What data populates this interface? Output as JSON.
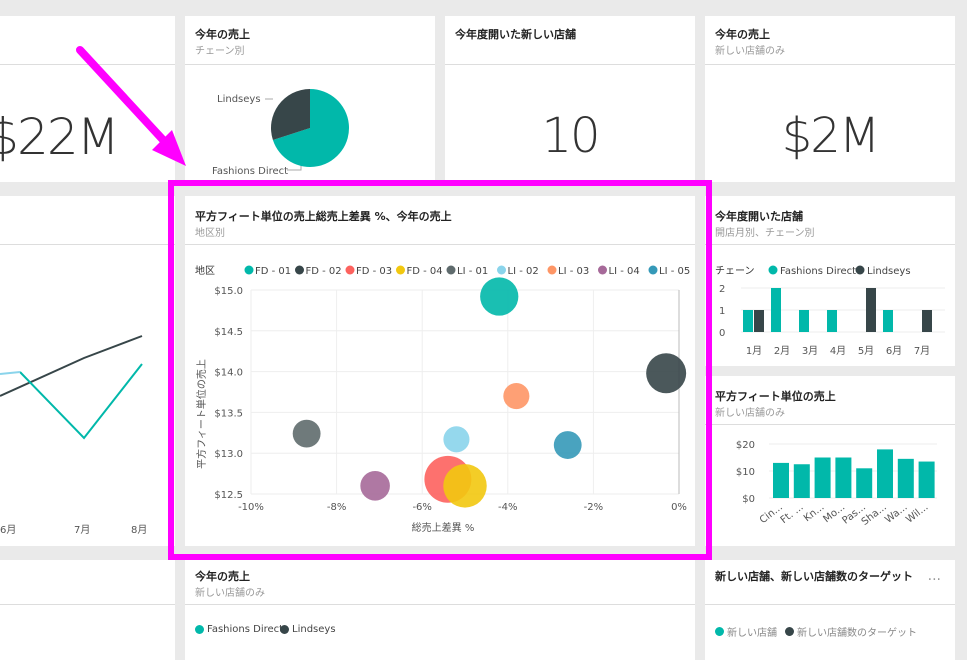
{
  "tiles": {
    "left_kpi": {
      "value": "$22M"
    },
    "sales_by_chain": {
      "title": "今年の売上",
      "subtitle": "チェーン別",
      "label_a": "Lindseys",
      "label_b": "Fashions Direct"
    },
    "new_stores": {
      "title": "今年度開いた新しい店舗",
      "value": "10"
    },
    "sales_new": {
      "title": "今年の売上",
      "subtitle": "新しい店舗のみ",
      "value": "$2M"
    },
    "line_left": {
      "xlabels": [
        "6月",
        "7月",
        "8月"
      ]
    },
    "bubble": {
      "title": "平方フィート単位の売上総売上差異 %、今年の売上",
      "subtitle": "地区別",
      "legend_title": "地区",
      "ylabel": "平方フィート単位の売上",
      "xlabel": "総売上差異 %",
      "yticks": [
        "$15.0",
        "$14.5",
        "$14.0",
        "$13.5",
        "$13.0",
        "$12.5"
      ],
      "xticks": [
        "-10%",
        "-8%",
        "-6%",
        "-4%",
        "-2%",
        "0%"
      ]
    },
    "opened": {
      "title": "今年度開いた店舗",
      "subtitle": "開店月別、チェーン別",
      "legend_title": "チェーン",
      "legend_a": "Fashions Direct",
      "legend_b": "Lindseys",
      "yticks": [
        "2",
        "1",
        "0"
      ],
      "xlabels": [
        "1月",
        "2月",
        "3月",
        "4月",
        "5月",
        "6月",
        "7月"
      ]
    },
    "sqft": {
      "title": "平方フィート単位の売上",
      "subtitle": "新しい店舗のみ",
      "yticks": [
        "$20",
        "$10",
        "$0"
      ],
      "xlabels": [
        "Cin...",
        "Ft. ...",
        "Kn...",
        "Mo...",
        "Pas...",
        "Sha...",
        "Wa...",
        "Wil..."
      ]
    },
    "bottom_mid": {
      "title": "今年の売上",
      "subtitle": "新しい店舗のみ",
      "legend_a": "Fashions Direct",
      "legend_b": "Lindseys"
    },
    "bottom_right": {
      "title": "新しい店舗、新しい店舗数のターゲット",
      "ellipsis": "...",
      "legend_a": "新しい店舗",
      "legend_b": "新しい店舗数のターゲット"
    }
  },
  "colors": {
    "teal": "#01b8aa",
    "dark": "#374649",
    "red": "#fd625e",
    "yellow": "#f2c80f",
    "gray": "#5f6b6d",
    "lightblue": "#8ad4eb",
    "orange": "#fe9666",
    "purple": "#a66999",
    "blue": "#3599b8",
    "magenta": "#ff00ff"
  },
  "chart_data": [
    {
      "type": "scatter",
      "title": "平方フィート単位の売上総売上差異 %、今年の売上",
      "xlabel": "総売上差異 %",
      "ylabel": "平方フィート単位の売上",
      "xlim": [
        -10,
        0
      ],
      "ylim": [
        12.5,
        15.0
      ],
      "legend": "top",
      "series": [
        {
          "name": "FD - 01",
          "color": "#01b8aa",
          "points": [
            {
              "x": -4.2,
              "y": 14.92,
              "size": 22
            }
          ]
        },
        {
          "name": "FD - 02",
          "color": "#374649",
          "points": [
            {
              "x": -0.3,
              "y": 13.98,
              "size": 23
            }
          ]
        },
        {
          "name": "FD - 03",
          "color": "#fd625e",
          "points": [
            {
              "x": -5.4,
              "y": 12.68,
              "size": 27
            }
          ]
        },
        {
          "name": "FD - 04",
          "color": "#f2c80f",
          "points": [
            {
              "x": -5.0,
              "y": 12.6,
              "size": 25
            }
          ]
        },
        {
          "name": "LI - 01",
          "color": "#5f6b6d",
          "points": [
            {
              "x": -8.7,
              "y": 13.24,
              "size": 16
            }
          ]
        },
        {
          "name": "LI - 02",
          "color": "#8ad4eb",
          "points": [
            {
              "x": -5.2,
              "y": 13.17,
              "size": 15
            }
          ]
        },
        {
          "name": "LI - 03",
          "color": "#fe9666",
          "points": [
            {
              "x": -3.8,
              "y": 13.7,
              "size": 15
            }
          ]
        },
        {
          "name": "LI - 04",
          "color": "#a66999",
          "points": [
            {
              "x": -7.1,
              "y": 12.6,
              "size": 17
            }
          ]
        },
        {
          "name": "LI - 05",
          "color": "#3599b8",
          "points": [
            {
              "x": -2.6,
              "y": 13.1,
              "size": 16
            }
          ]
        }
      ]
    },
    {
      "type": "pie",
      "categories": [
        "Fashions Direct",
        "Lindseys"
      ],
      "values": [
        70,
        30
      ],
      "colors": [
        "#01b8aa",
        "#374649"
      ]
    },
    {
      "type": "bar",
      "categories": [
        "1月",
        "2月",
        "3月",
        "4月",
        "5月",
        "6月",
        "7月"
      ],
      "series": [
        {
          "name": "Fashions Direct",
          "values": [
            1,
            2,
            1,
            1,
            0,
            1,
            0
          ]
        },
        {
          "name": "Lindseys",
          "values": [
            1,
            0,
            0,
            0,
            2,
            0,
            1
          ]
        }
      ],
      "ylim": [
        0,
        2
      ]
    },
    {
      "type": "bar",
      "categories": [
        "Cin...",
        "Ft. ...",
        "Kn...",
        "Mo...",
        "Pas...",
        "Sha...",
        "Wa...",
        "Wil..."
      ],
      "values": [
        13,
        12.5,
        15,
        15,
        11,
        18,
        14.5,
        13.5
      ],
      "ylim": [
        0,
        20
      ]
    },
    {
      "type": "line",
      "categories": [
        "6月",
        "7月",
        "8月"
      ],
      "series": [
        {
          "color": "#374649",
          "values": [
            13.5,
            14.2,
            14.6
          ]
        },
        {
          "color": "#01b8aa",
          "values": [
            13.6,
            13.2,
            14.0
          ]
        }
      ]
    }
  ]
}
